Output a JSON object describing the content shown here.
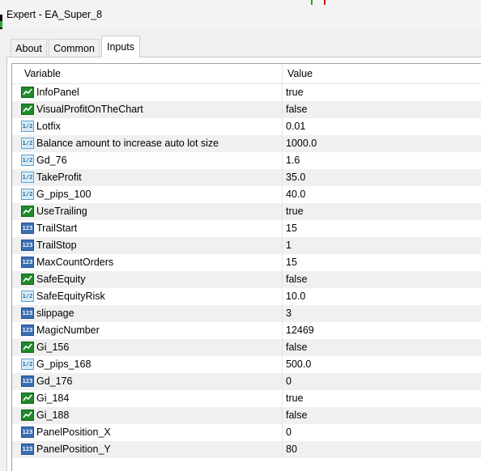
{
  "window": {
    "title": "Expert - EA_Super_8"
  },
  "tabs": [
    {
      "label": "About",
      "active": false
    },
    {
      "label": "Common",
      "active": false
    },
    {
      "label": "Inputs",
      "active": true
    }
  ],
  "table": {
    "headers": {
      "variable": "Variable",
      "value": "Value"
    },
    "rows": [
      {
        "name": "InfoPanel",
        "type": "bool",
        "value": "true"
      },
      {
        "name": "VisualProfitOnTheChart",
        "type": "bool",
        "value": "false"
      },
      {
        "name": "Lotfix",
        "type": "double",
        "value": "0.01"
      },
      {
        "name": "Balance amount to increase auto lot size",
        "type": "double",
        "value": "1000.0"
      },
      {
        "name": "Gd_76",
        "type": "double",
        "value": "1.6"
      },
      {
        "name": "TakeProfit",
        "type": "double",
        "value": "35.0"
      },
      {
        "name": "G_pips_100",
        "type": "double",
        "value": "40.0"
      },
      {
        "name": "UseTrailing",
        "type": "bool",
        "value": "true"
      },
      {
        "name": "TrailStart",
        "type": "int",
        "value": "15"
      },
      {
        "name": "TrailStop",
        "type": "int",
        "value": "1"
      },
      {
        "name": "MaxCountOrders",
        "type": "int",
        "value": "15"
      },
      {
        "name": "SafeEquity",
        "type": "bool",
        "value": "false"
      },
      {
        "name": "SafeEquityRisk",
        "type": "double",
        "value": "10.0"
      },
      {
        "name": "slippage",
        "type": "int",
        "value": "3"
      },
      {
        "name": "MagicNumber",
        "type": "int",
        "value": "12469"
      },
      {
        "name": "Gi_156",
        "type": "bool",
        "value": "false"
      },
      {
        "name": "G_pips_168",
        "type": "double",
        "value": "500.0"
      },
      {
        "name": "Gd_176",
        "type": "int",
        "value": "0"
      },
      {
        "name": "Gi_184",
        "type": "bool",
        "value": "true"
      },
      {
        "name": "Gi_188",
        "type": "bool",
        "value": "false"
      },
      {
        "name": "PanelPosition_X",
        "type": "int",
        "value": "0"
      },
      {
        "name": "PanelPosition_Y",
        "type": "int",
        "value": "80"
      }
    ]
  },
  "icons": {
    "bool": "bool-type-icon",
    "double": "double-type-icon",
    "int": "int-type-icon"
  },
  "colors": {
    "bool_icon": "#1f8a2a",
    "double_icon": "#d8ecf8",
    "int_icon": "#3b6fb5",
    "alt_row": "#f0f0f0"
  }
}
